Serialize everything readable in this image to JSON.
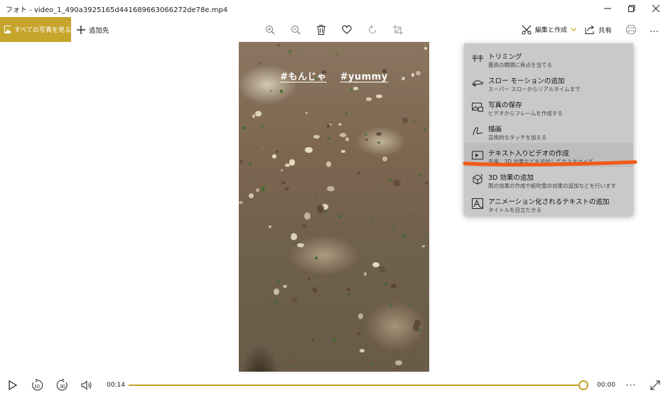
{
  "window": {
    "title": "フォト - video_1_490a3925165d441689663066272de78e.mp4",
    "controls": {
      "minimize": "—",
      "maximize": "❐",
      "close": "✕"
    }
  },
  "toolbar": {
    "all_photos_label": "すべての写真を見る",
    "add_to_label": "追加先",
    "edit_create_label": "編集と作成",
    "share_label": "共有",
    "more_label": "…",
    "icons": [
      "zoom-in-icon",
      "zoom-out-icon",
      "delete-icon",
      "heart-icon",
      "rotate-icon",
      "crop-icon"
    ]
  },
  "video": {
    "caption_tags": [
      "#もんじゃ",
      "#yummy"
    ]
  },
  "menu": {
    "items": [
      {
        "title": "トリミング",
        "subtitle": "最高の瞬間に焦点を当てる",
        "icon": "trim-icon"
      },
      {
        "title": "スロー モーションの追加",
        "subtitle": "スーパー スローからリアルタイムまで",
        "icon": "slow-motion-icon"
      },
      {
        "title": "写真の保存",
        "subtitle": "ビデオからフレームを作成する",
        "icon": "save-photo-icon"
      },
      {
        "title": "描画",
        "subtitle": "芸術的なタッチを加える",
        "icon": "draw-icon"
      },
      {
        "title": "テキスト入りビデオの作成",
        "subtitle": "音楽、3D 効果などを追加してカスタマイズ",
        "icon": "video-text-icon"
      },
      {
        "title": "3D 効果の追加",
        "subtitle": "雨の効果の作成や紙吹雪の効果の追加などを行います",
        "icon": "3d-effects-icon"
      },
      {
        "title": "アニメーション化されるテキストの追加",
        "subtitle": "タイトルを目立たせる",
        "icon": "animated-text-icon"
      }
    ],
    "highlighted_index": 4,
    "annotation_color": "#f05a1a"
  },
  "playback": {
    "current_time": "00:14",
    "remaining_time": "00:00",
    "progress": 1.0,
    "skip_back_label": "10",
    "skip_forward_label": "30",
    "more_label": "···"
  },
  "colors": {
    "accent": "#c6a52c",
    "menu_bg": "#c9c9c9"
  }
}
